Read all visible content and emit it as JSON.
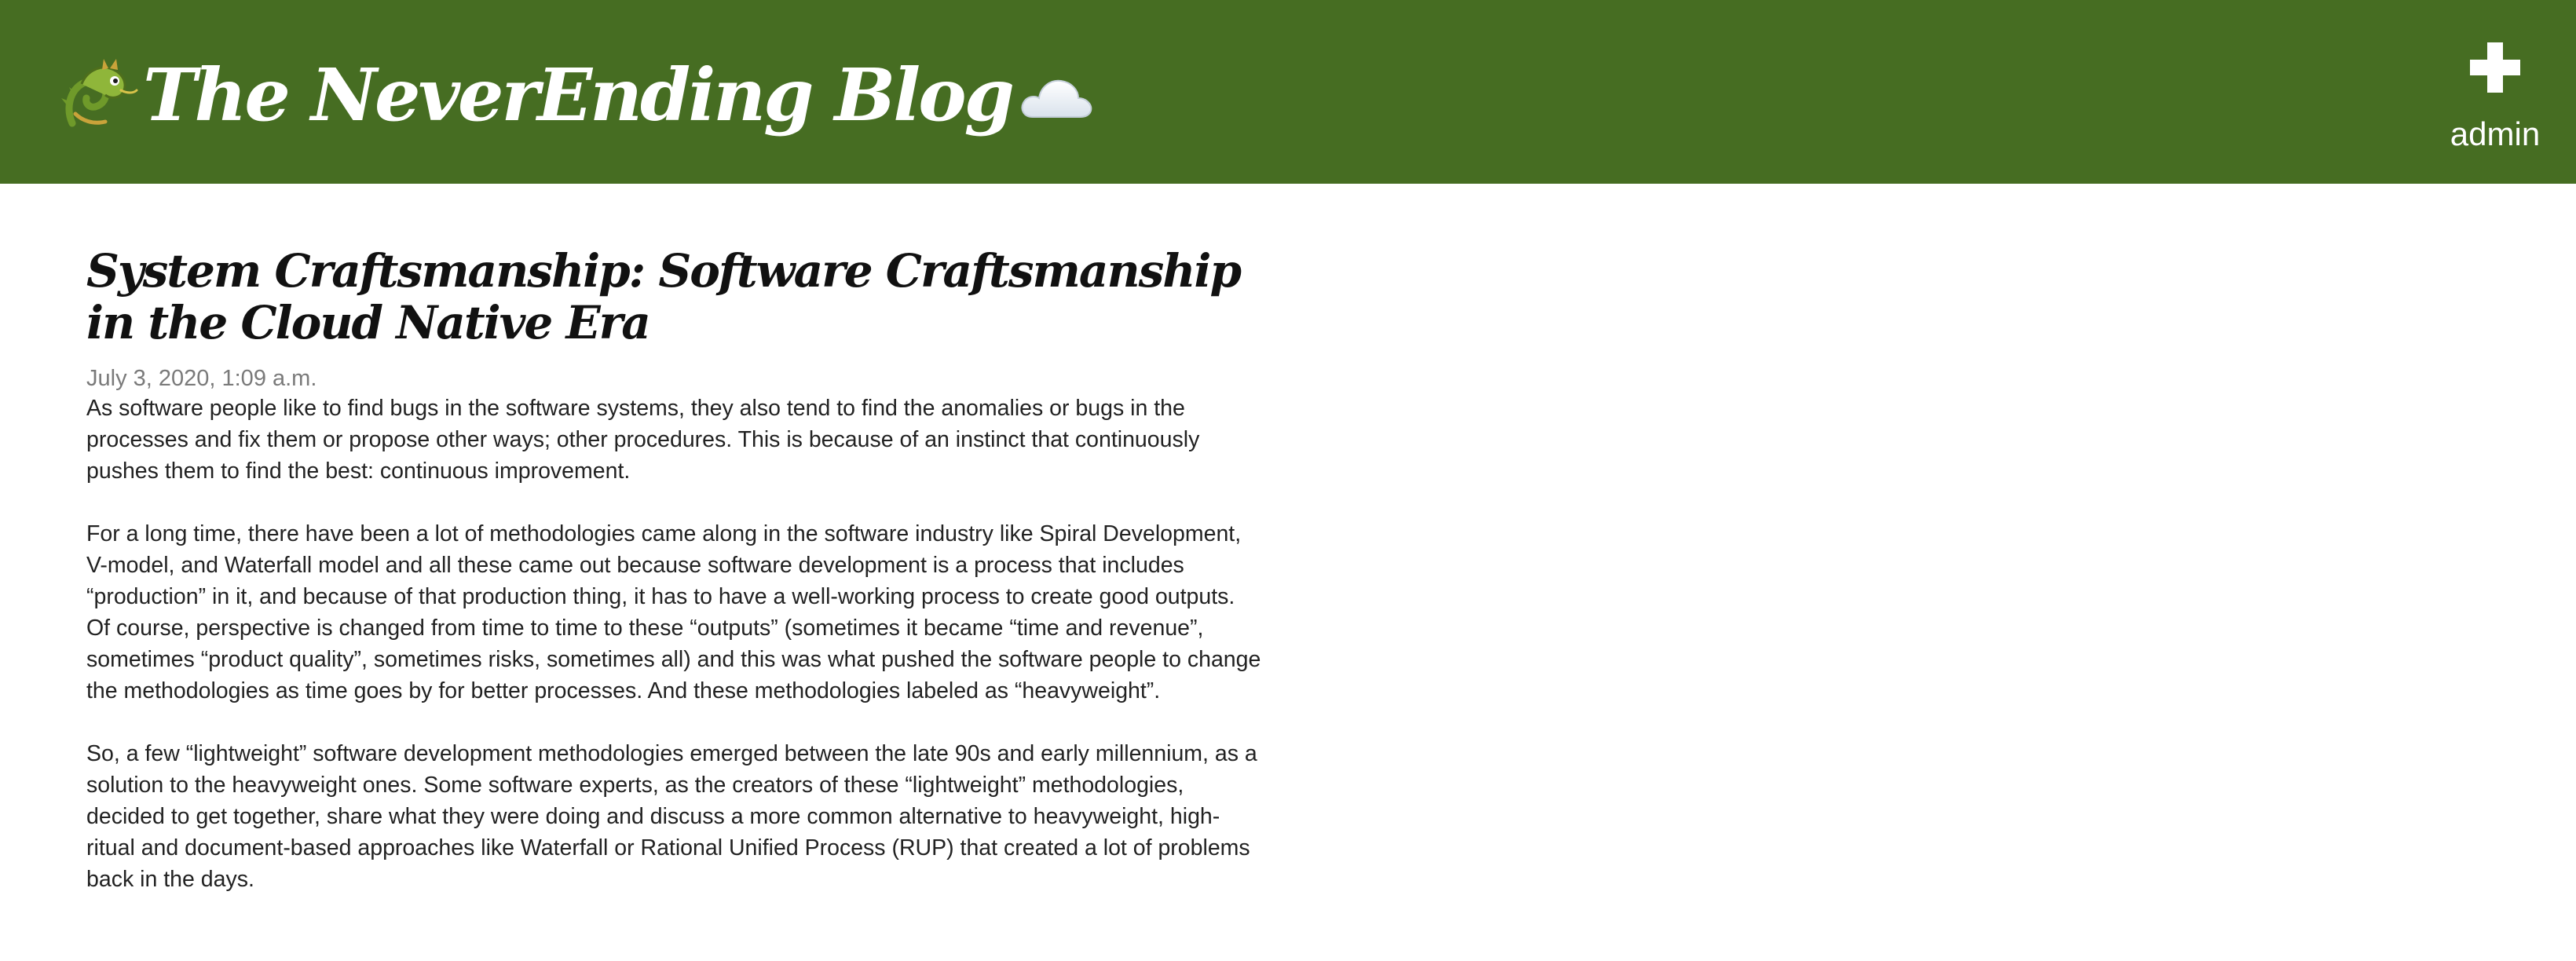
{
  "header": {
    "blog_title": "The NeverEnding Blog",
    "logo_icon": "dragon-icon",
    "cloud_icon": "cloud-icon",
    "admin_icon": "plus-icon",
    "admin_label": "admin",
    "background_color": "#466d22"
  },
  "post": {
    "title": "System Craftsmanship: Software Craftsmanship in the Cloud Native Era",
    "date": "July 3, 2020, 1:09 a.m.",
    "paragraphs": [
      "As software people like to find bugs in the software systems, they also tend to find the anomalies or bugs in the processes and fix them or propose other ways; other procedures. This is because of an instinct that continuously pushes them to find the best: continuous improvement.",
      "For a long time, there have been a lot of methodologies came along in the software industry like Spiral Development, V-model, and Waterfall model and all these came out because software development is a process that includes “production” in it, and because of that production thing, it has to have a well-working process to create good outputs. Of course, perspective is changed from time to time to these “outputs” (sometimes it became “time and revenue”, sometimes “product quality”, sometimes risks, sometimes all) and this was what pushed the software people to change the methodologies as time goes by for better processes. And these methodologies labeled as “heavyweight”.",
      "So, a few “lightweight” software development methodologies emerged between the late 90s and early millennium, as a solution to the heavyweight ones. Some software experts, as the creators of these “lightweight” methodologies, decided to get together, share what they were doing and discuss a more common alternative to heavyweight, high-ritual and document-based approaches like Waterfall or Rational Unified Process (RUP) that created a lot of problems back in the days."
    ]
  }
}
